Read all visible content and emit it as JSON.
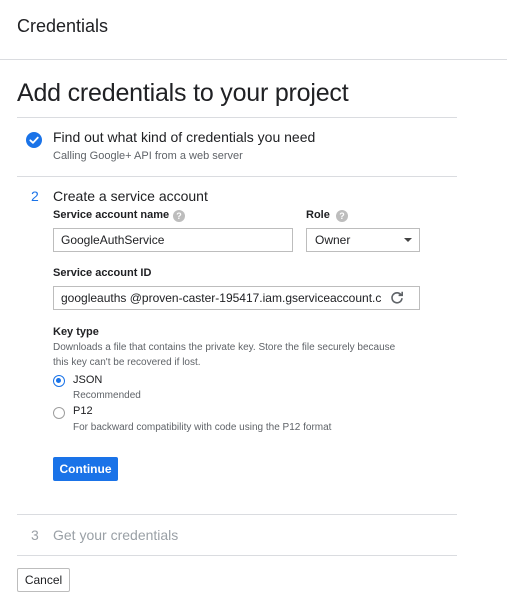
{
  "header": {
    "title": "Credentials"
  },
  "page_title": "Add credentials to your project",
  "step1": {
    "title": "Find out what kind of credentials you need",
    "subtitle": "Calling Google+ API from a web server"
  },
  "step2": {
    "number": "2",
    "title": "Create a service account",
    "service_account_name": {
      "label": "Service account name",
      "value": "GoogleAuthService"
    },
    "role": {
      "label": "Role",
      "value": "Owner"
    },
    "service_account_id": {
      "label": "Service account ID",
      "value": "googleauths @proven-caster-195417.iam.gserviceaccount.c"
    },
    "key_type": {
      "label": "Key type",
      "description": "Downloads a file that contains the private key. Store the file securely because this key can't be recovered if lost.",
      "options": [
        {
          "label": "JSON",
          "sub": "Recommended",
          "selected": true
        },
        {
          "label": "P12",
          "sub": "For backward compatibility with code using the P12 format",
          "selected": false
        }
      ]
    },
    "continue_label": "Continue"
  },
  "step3": {
    "number": "3",
    "title": "Get your credentials"
  },
  "cancel_label": "Cancel",
  "colors": {
    "accent": "#1a73e8",
    "muted": "#9aa0a6"
  },
  "icons": {
    "step1": "check-circle-icon",
    "help": "help-icon",
    "refresh": "refresh-icon",
    "dropdown": "caret-down-icon"
  }
}
